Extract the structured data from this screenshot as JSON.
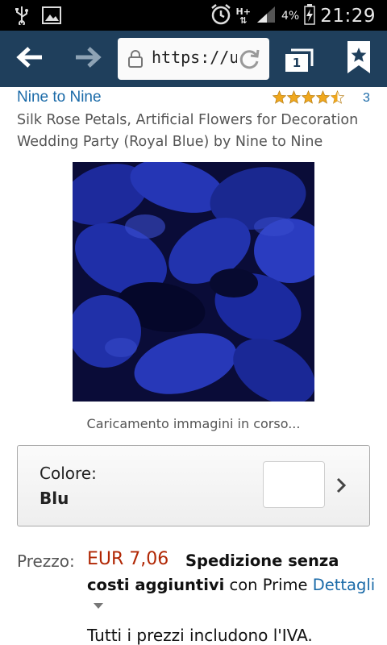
{
  "status_bar": {
    "icons": [
      "usb-icon",
      "image-icon",
      "alarm-icon",
      "network-hplus-icon",
      "signal-icon",
      "battery-charging-icon"
    ],
    "network_label": "H+",
    "battery_percent": "4%",
    "time": "21:29"
  },
  "browser": {
    "url": "https://u",
    "tab_count": "1"
  },
  "product": {
    "brand": "Nine to Nine",
    "rating_stars": 4.5,
    "rating_count": "3",
    "title": "Silk Rose Petals, Artificial Flowers for Decoration Wedding Party (Royal Blue) by Nine to Nine",
    "image_loading_text": "Caricamento immagini in corso...",
    "color_label": "Colore:",
    "color_value": "Blu",
    "price_label": "Prezzo:",
    "price_value": "EUR 7,06",
    "shipping_bold_1": "Spedizione senza",
    "shipping_bold_2": "costi aggiuntivi",
    "shipping_plain": " con Prime ",
    "shipping_link": "Dettagli",
    "vat_note": "Tutti i prezzi includono l'IVA."
  },
  "colors": {
    "toolbar_bg": "#1f3f5c",
    "link": "#1a6aa8",
    "price": "#b12704",
    "star": "#f0a81e"
  }
}
